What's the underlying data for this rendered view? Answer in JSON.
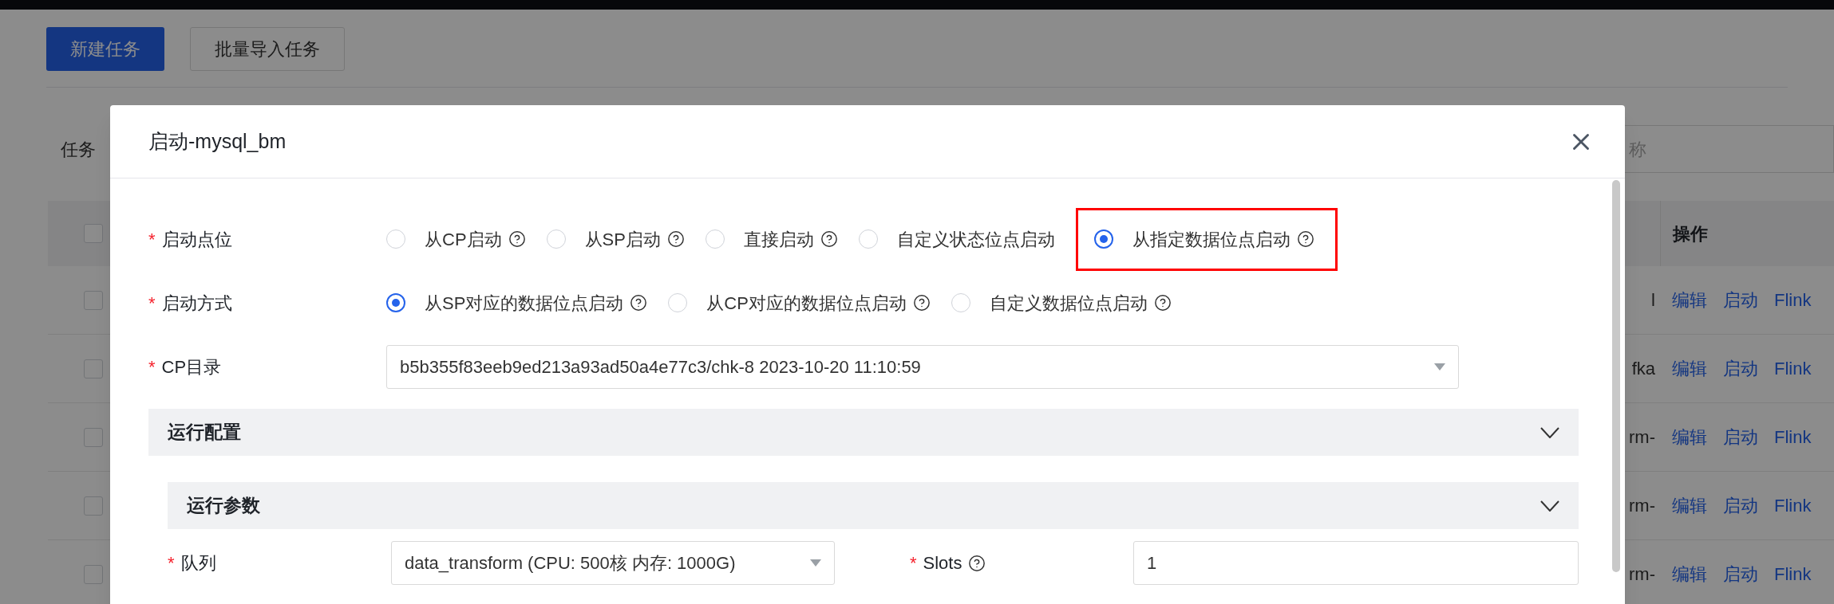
{
  "page": {
    "buttons": [
      {
        "label": "新建任务",
        "kind": "primary"
      },
      {
        "label": "批量导入任务",
        "kind": "default"
      }
    ],
    "filter_label": "任务",
    "search": {
      "placeholder": "称"
    },
    "table": {
      "action_header": "操作",
      "header_checked": false,
      "rows": [
        {
          "checked": false,
          "cell": "l",
          "actions": [
            "编辑",
            "启动",
            "Flink"
          ]
        },
        {
          "checked": false,
          "cell": "fka",
          "actions": [
            "编辑",
            "启动",
            "Flink"
          ]
        },
        {
          "checked": false,
          "cell": "rm-",
          "actions": [
            "编辑",
            "启动",
            "Flink"
          ]
        },
        {
          "checked": false,
          "cell": "rm-",
          "actions": [
            "编辑",
            "启动",
            "Flink"
          ]
        },
        {
          "checked": false,
          "cell": "rm-",
          "actions": [
            "编辑",
            "启动",
            "Flink"
          ]
        }
      ]
    }
  },
  "dialog": {
    "title": "启动-mysql_bm",
    "fields": [
      {
        "kind": "radio",
        "label": "启动点位",
        "required_mark": "*",
        "options": [
          {
            "label": "从CP启动",
            "help": true,
            "selected": false,
            "highlighted": false
          },
          {
            "label": "从SP启动",
            "help": true,
            "selected": false,
            "highlighted": false
          },
          {
            "label": "直接启动",
            "help": true,
            "selected": false,
            "highlighted": false
          },
          {
            "label": "自定义状态位点启动",
            "help": false,
            "selected": false,
            "highlighted": false
          },
          {
            "label": "从指定数据位点启动",
            "help": true,
            "selected": true,
            "highlighted": true
          }
        ]
      },
      {
        "kind": "radio",
        "label": "启动方式",
        "required_mark": "*",
        "options": [
          {
            "label": "从SP对应的数据位点启动",
            "help": true,
            "selected": true,
            "highlighted": false
          },
          {
            "label": "从CP对应的数据位点启动",
            "help": true,
            "selected": false,
            "highlighted": false
          },
          {
            "label": "自定义数据位点启动",
            "help": true,
            "selected": false,
            "highlighted": false
          }
        ]
      },
      {
        "kind": "select",
        "label": "CP目录",
        "required_mark": "*",
        "value": "b5b355f83eeb9ed213a93ad50a4e77c3/chk-8 2023-10-20 11:10:59"
      }
    ],
    "sections": [
      {
        "title": "运行配置",
        "children": [
          {
            "title": "运行参数",
            "fields": [
              {
                "kind": "select",
                "label": "队列",
                "required_mark": "*",
                "value": "data_transform (CPU: 500核 内存: 1000G)"
              },
              {
                "kind": "input",
                "label": "Slots",
                "required_mark": "*",
                "help": true,
                "value": "1"
              }
            ]
          }
        ]
      }
    ]
  }
}
